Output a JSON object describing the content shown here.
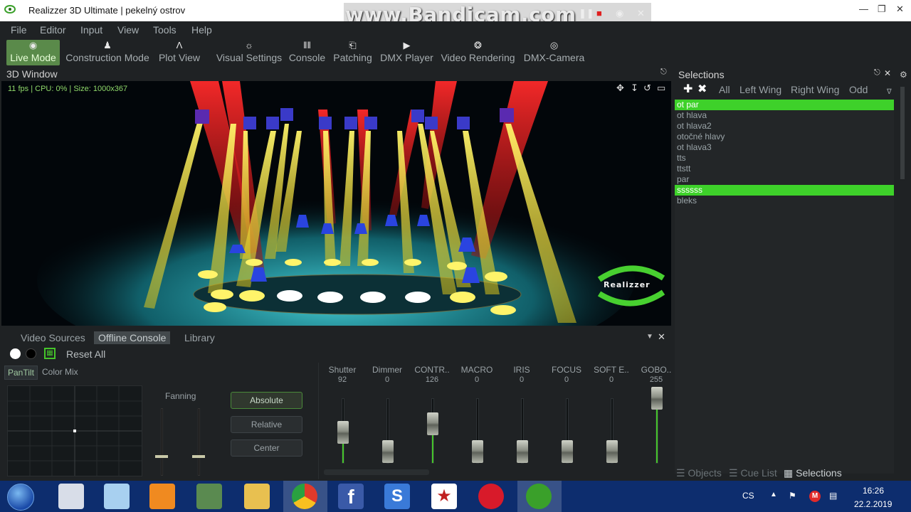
{
  "window": {
    "title": "Realizzer 3D Ultimate | pekelný ostrov"
  },
  "watermark": {
    "text": "www.Bandicam.com"
  },
  "menu": [
    "File",
    "Editor",
    "Input",
    "View",
    "Tools",
    "Help"
  ],
  "toolbar": [
    {
      "label": "Live Mode",
      "icon": "eye-icon",
      "active": true
    },
    {
      "label": "Construction Mode",
      "icon": "person-icon"
    },
    {
      "label": "Plot View",
      "icon": "compass-icon"
    },
    {
      "label": "Visual Settings",
      "icon": "sun-icon"
    },
    {
      "label": "Console",
      "icon": "sliders-icon"
    },
    {
      "label": "Patching",
      "icon": "plug-icon"
    },
    {
      "label": "DMX Player",
      "icon": "play-icon"
    },
    {
      "label": "Video Rendering",
      "icon": "film-reel-icon"
    },
    {
      "label": "DMX-Camera",
      "icon": "camera-icon"
    }
  ],
  "viewport": {
    "title": "3D Window",
    "status": "11 fps | CPU: 0% | Size: 1000x367",
    "logo": "Realizzer"
  },
  "selections": {
    "title": "Selections",
    "filters": [
      "All",
      "Left Wing",
      "Right Wing",
      "Odd"
    ],
    "items": [
      {
        "label": "ot par",
        "selected": true
      },
      {
        "label": "ot hlava",
        "selected": false
      },
      {
        "label": "ot hlava2",
        "selected": false
      },
      {
        "label": "otočné hlavy",
        "selected": false
      },
      {
        "label": "ot hlava3",
        "selected": false
      },
      {
        "label": "tts",
        "selected": false
      },
      {
        "label": "ttstt",
        "selected": false
      },
      {
        "label": "par",
        "selected": false
      },
      {
        "label": "ssssss",
        "selected": true
      },
      {
        "label": "bleks",
        "selected": false
      }
    ],
    "bottom_tabs": [
      "Objects",
      "Cue List",
      "Selections"
    ]
  },
  "console": {
    "tabs": [
      "Video Sources",
      "Offline Console",
      "Library"
    ],
    "active_tab": "Offline Console",
    "reset_label": "Reset All",
    "subtabs": [
      "PanTilt",
      "Color Mix"
    ],
    "fanning_label": "Fanning",
    "modes": [
      "Absolute",
      "Relative",
      "Center"
    ],
    "channels": [
      {
        "name": "Shutter",
        "value": 92
      },
      {
        "name": "Dimmer",
        "value": 0
      },
      {
        "name": "CONTR..",
        "value": 126
      },
      {
        "name": "MACRO",
        "value": 0
      },
      {
        "name": "IRIS",
        "value": 0
      },
      {
        "name": "FOCUS",
        "value": 0
      },
      {
        "name": "SOFT E..",
        "value": 0
      },
      {
        "name": "GOBO..",
        "value": 255
      }
    ]
  },
  "taskbar": {
    "language": "CS",
    "time": "16:26",
    "date": "22.2.2019"
  }
}
